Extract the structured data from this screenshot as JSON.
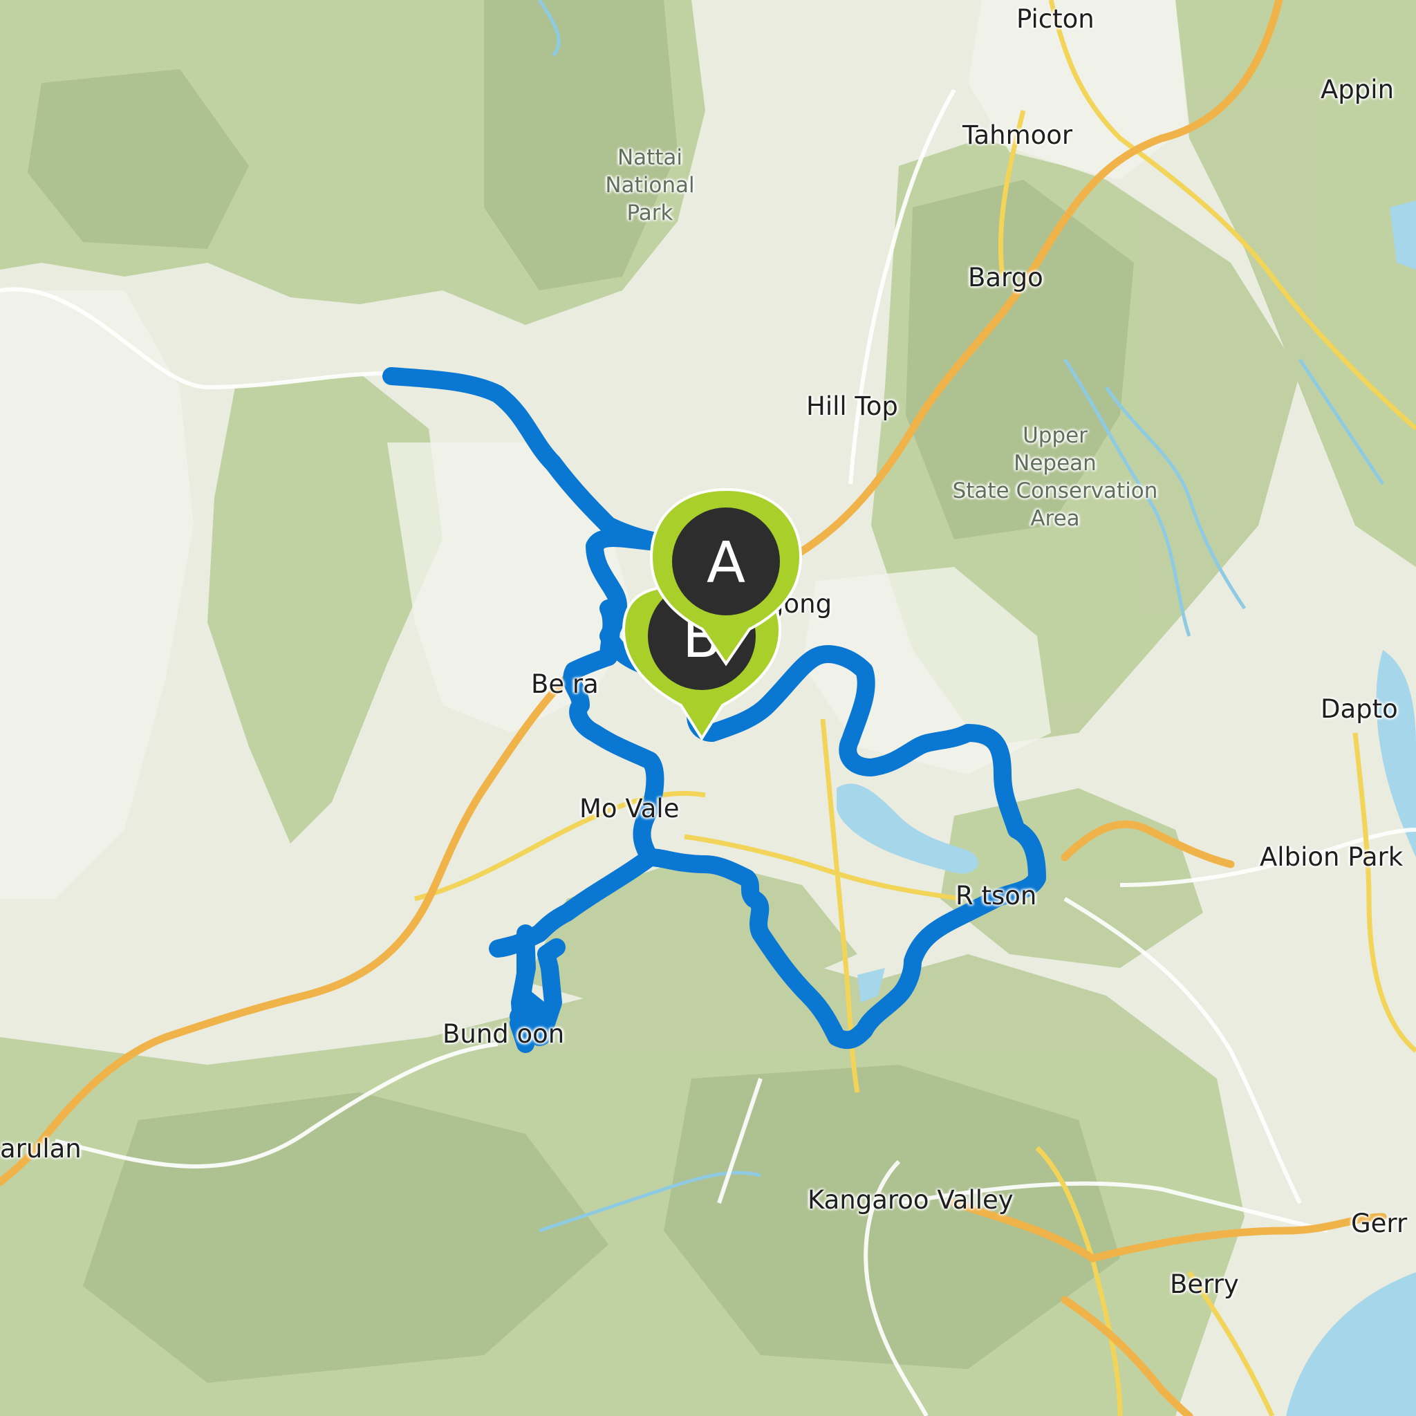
{
  "map": {
    "places": {
      "picton": "Picton",
      "appin": "Appin",
      "tahmoor": "Tahmoor",
      "bargo": "Bargo",
      "hill_top": "Hill Top",
      "mittagong": "gong",
      "bowral": "Be  ra",
      "moss_vale": "Mo    Vale",
      "robertson": "R      tson",
      "dapto": "Dapto",
      "albion_park": "Albion Park",
      "bundanoon": "Bund    oon",
      "exeter": "",
      "marulan": "arulan",
      "kangaroo_valley": "Kangaroo Valley",
      "berry": "Berry",
      "gerringong": "Gerr"
    },
    "parks": {
      "nattai": [
        "Nattai",
        "National",
        "Park"
      ],
      "upper_nepean": [
        "Upper",
        "Nepean",
        "State Conservation",
        "Area"
      ]
    },
    "markers": {
      "start": "A",
      "end": "B"
    },
    "colors": {
      "route": "#0a78d2",
      "marker_fill": "#a8cf2a",
      "marker_core": "#2d2d2d",
      "highway": "#f2b445",
      "road": "#f6df6f",
      "water": "#9fd3e8",
      "forest": "#b6cb95",
      "land": "#e9ecdf"
    }
  }
}
